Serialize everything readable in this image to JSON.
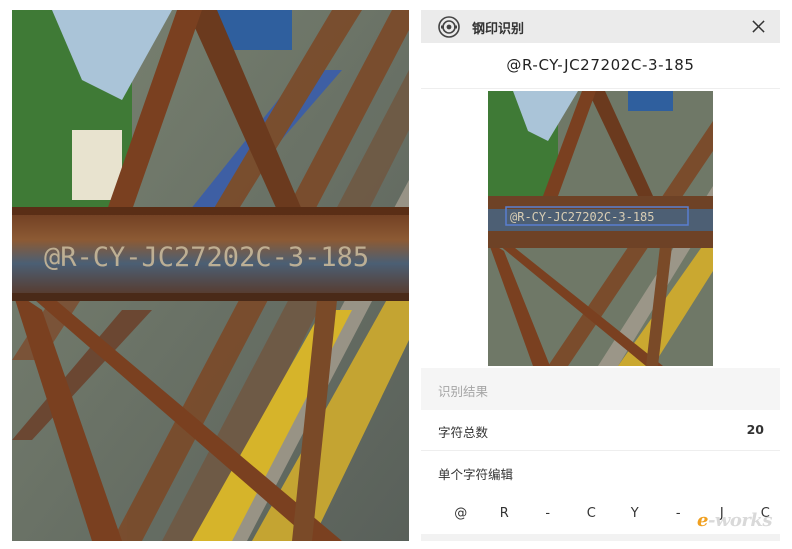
{
  "photo": {
    "engraved_text": "@R-CY-JC27202C-3-185"
  },
  "app": {
    "title": "钢印识别",
    "recognized_code": "@R-CY-JC27202C-3-185",
    "thumbnail_overlay_text": "@R-CY-JC27202C-3-185",
    "section_title": "识别结果",
    "total_chars_label": "字符总数",
    "total_chars_value": "20",
    "edit_label": "单个字符编辑",
    "characters": [
      "@",
      "R",
      "-",
      "C",
      "Y",
      "-",
      "J",
      "C"
    ]
  },
  "icons": {
    "app_icon": "seal-icon",
    "close": "close-icon"
  },
  "colors": {
    "titlebar": "#ebebeb",
    "section_bg": "#f5f5f5",
    "rust": "#8a4a22",
    "steel_blue": "#3f5670",
    "highlight_box": "#5a7fd0"
  },
  "watermark": {
    "e_letter": "e",
    "rest": "-works"
  }
}
